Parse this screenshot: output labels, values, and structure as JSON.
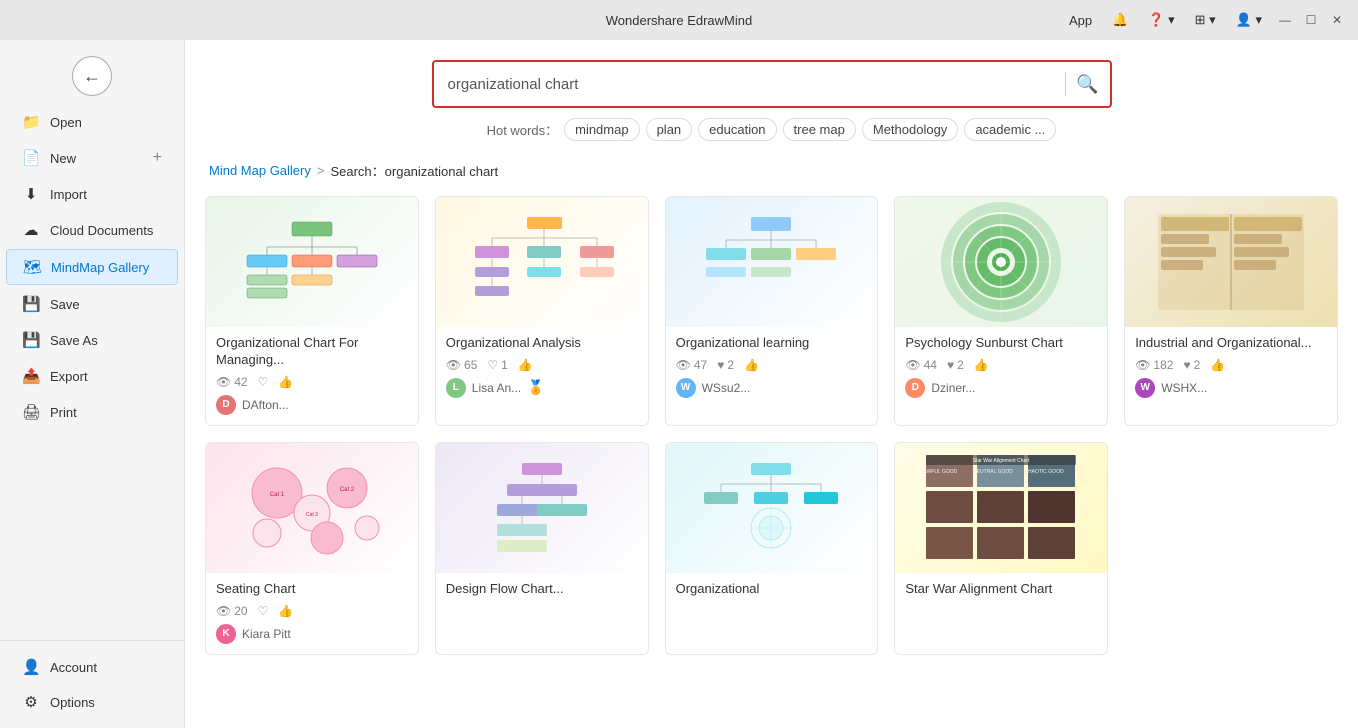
{
  "app": {
    "title": "Wondershare EdrawMind"
  },
  "titleBar": {
    "windowButtons": {
      "minimize": "—",
      "maximize": "☐",
      "close": "✕"
    },
    "topRight": {
      "appLabel": "App",
      "notificationIcon": "bell",
      "helpIcon": "help",
      "gridIcon": "grid",
      "userIcon": "user"
    }
  },
  "sidebar": {
    "backButton": "←",
    "items": [
      {
        "id": "open",
        "label": "Open",
        "icon": "📁"
      },
      {
        "id": "new",
        "label": "New",
        "icon": "📄",
        "hasPlus": true
      },
      {
        "id": "import",
        "label": "Import",
        "icon": "⬇"
      },
      {
        "id": "cloud",
        "label": "Cloud Documents",
        "icon": "☁"
      },
      {
        "id": "mindmap-gallery",
        "label": "MindMap Gallery",
        "icon": "🗺",
        "active": true
      },
      {
        "id": "save",
        "label": "Save",
        "icon": "💾"
      },
      {
        "id": "save-as",
        "label": "Save As",
        "icon": "💾"
      },
      {
        "id": "export",
        "label": "Export",
        "icon": "📤"
      },
      {
        "id": "print",
        "label": "Print",
        "icon": "🖨"
      }
    ],
    "bottomItems": [
      {
        "id": "account",
        "label": "Account",
        "icon": "👤"
      },
      {
        "id": "options",
        "label": "Options",
        "icon": "⚙"
      }
    ]
  },
  "search": {
    "placeholder": "organizational chart",
    "value": "organizational chart",
    "hotWordsLabel": "Hot words：",
    "hotWords": [
      "mindmap",
      "plan",
      "education",
      "tree map",
      "Methodology",
      "academic ..."
    ]
  },
  "breadcrumb": {
    "gallery": "Mind Map Gallery",
    "separator": ">",
    "current": "Search：organizational chart"
  },
  "gallery": {
    "cards": [
      {
        "id": "card1",
        "title": "Organizational Chart For Managing...",
        "views": "42",
        "likes": "",
        "likesCount": "",
        "shares": "",
        "authorName": "DAfton...",
        "authorColor": "#e57373",
        "thumbType": "orgchart"
      },
      {
        "id": "card2",
        "title": "Organizational Analysis",
        "views": "65",
        "likes": "1",
        "shares": "",
        "authorName": "Lisa An...",
        "authorColor": "#81c784",
        "hasGoldBadge": true,
        "thumbType": "organalysis"
      },
      {
        "id": "card3",
        "title": "Organizational learning",
        "views": "47",
        "likes": "2",
        "shares": "",
        "authorName": "WSsu2...",
        "authorColor": "#64b5f6",
        "thumbType": "orglearning"
      },
      {
        "id": "card4",
        "title": "Psychology Sunburst Chart",
        "views": "44",
        "likes": "2",
        "shares": "",
        "authorName": "Dziner...",
        "authorInitial": "D",
        "authorColor": "#ff8a65",
        "thumbType": "psychology"
      },
      {
        "id": "card5",
        "title": "Industrial and Organizational...",
        "views": "182",
        "likes": "2",
        "shares": "",
        "authorName": "WSHX...",
        "authorColor": "#ab47bc",
        "thumbType": "industrial"
      },
      {
        "id": "card6",
        "title": "Seating Chart",
        "views": "20",
        "likes": "",
        "shares": "",
        "authorName": "Kiara Pitt",
        "authorColor": "#f06292",
        "thumbType": "seating"
      },
      {
        "id": "card7",
        "title": "Design Flow Chart...",
        "views": "",
        "likes": "",
        "shares": "",
        "authorName": "",
        "thumbType": "designflow"
      },
      {
        "id": "card8",
        "title": "Organizational",
        "views": "",
        "likes": "",
        "shares": "",
        "authorName": "",
        "thumbType": "org2"
      },
      {
        "id": "card9",
        "title": "Star War Alignment Chart",
        "views": "",
        "likes": "",
        "shares": "",
        "authorName": "",
        "thumbType": "starwars"
      }
    ]
  },
  "icons": {
    "eye": "👁",
    "heart": "♡",
    "heart_filled": "♥",
    "like": "👍",
    "share": "👍",
    "search": "🔍"
  }
}
